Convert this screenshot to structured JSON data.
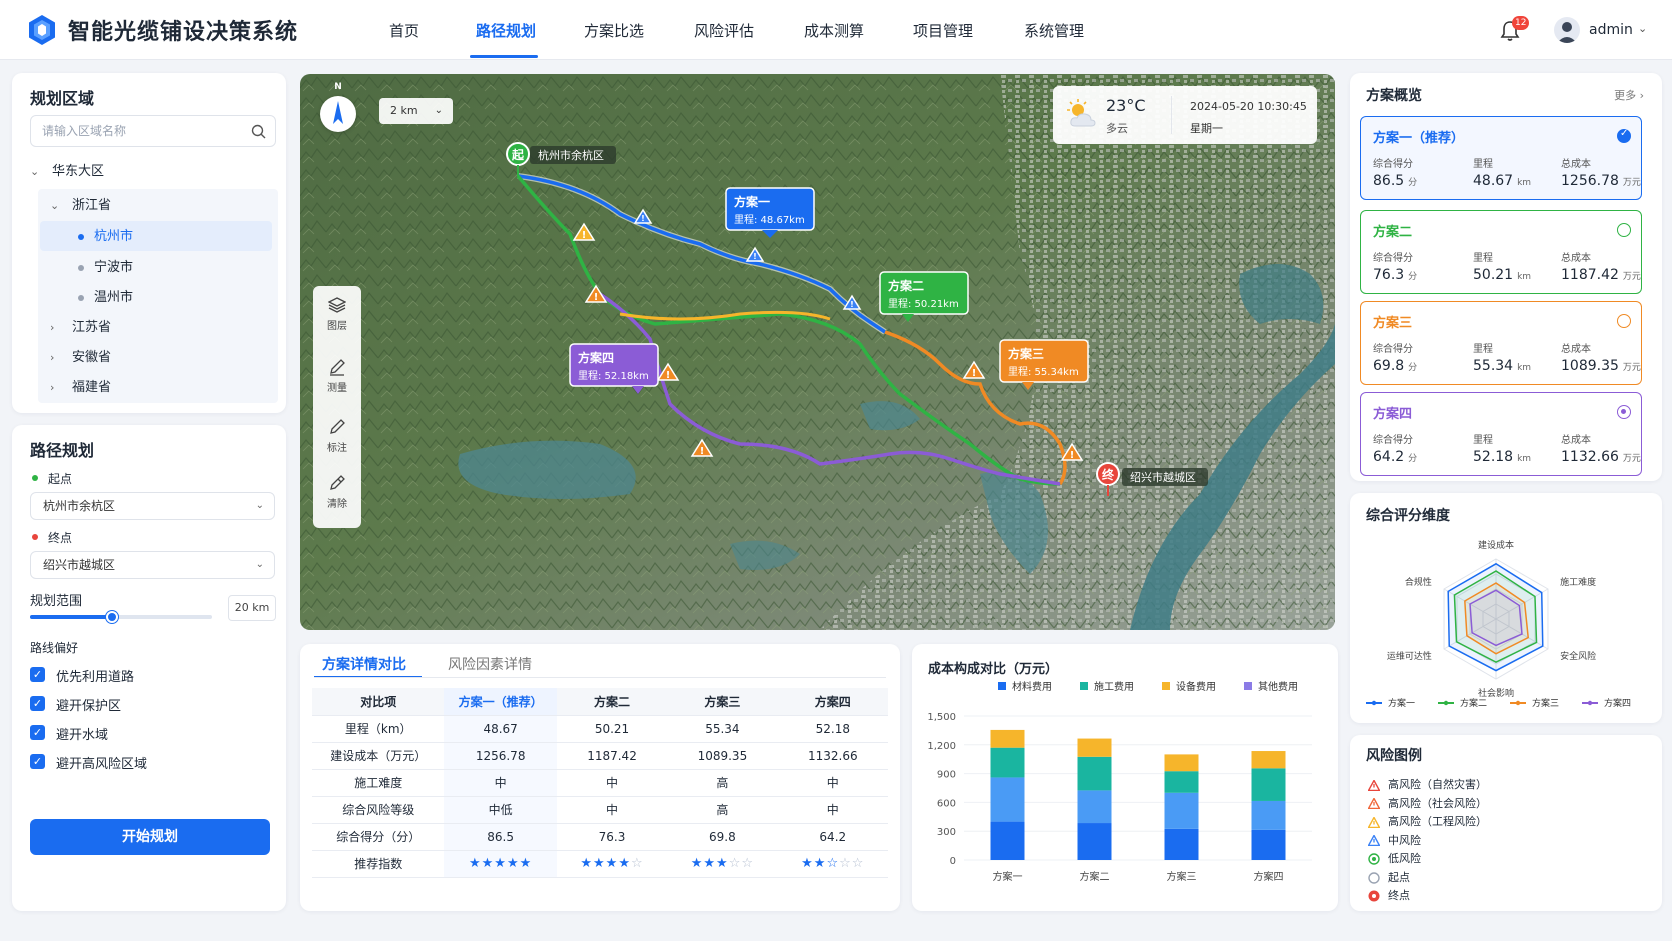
{
  "header": {
    "app_title": "智能光缆铺设决策系统",
    "nav": [
      "首页",
      "路径规划",
      "方案比选",
      "风险评估",
      "成本测算",
      "项目管理",
      "系统管理"
    ],
    "active_nav": "路径规划",
    "notification_count": "12",
    "username": "admin"
  },
  "region": {
    "title": "规划区域",
    "search_placeholder": "请输入区域名称",
    "tree": {
      "root": "华东大区",
      "province_open": "浙江省",
      "cities": [
        "杭州市",
        "宁波市",
        "温州市"
      ],
      "selected_city": "杭州市",
      "other_provinces": [
        "江苏省",
        "安徽省",
        "福建省"
      ]
    }
  },
  "route": {
    "title": "路径规划",
    "start_label": "起点",
    "start_value": "杭州市余杭区",
    "end_label": "终点",
    "end_value": "绍兴市越城区",
    "range_label": "规划范围",
    "range_value": "20 km",
    "range_fraction": 0.45,
    "pref_label": "路线偏好",
    "prefs": [
      "优先利用道路",
      "避开保护区",
      "避开水域",
      "避开高风险区域"
    ],
    "start_button": "开始规划"
  },
  "map": {
    "scale": "2 km",
    "compass": "N",
    "weather": {
      "temp": "23°C",
      "desc": "多云",
      "datetime": "2024-05-20 10:30:45",
      "weekday": "星期一"
    },
    "tools": [
      "图层",
      "测量",
      "标注",
      "清除"
    ],
    "start_marker": "起",
    "start_name": "杭州市余杭区",
    "end_marker": "终",
    "end_name": "绍兴市越城区",
    "routes": [
      {
        "name": "方案一",
        "distance": "里程: 48.67km",
        "color": "#1a6cf0"
      },
      {
        "name": "方案二",
        "distance": "里程: 50.21km",
        "color": "#2fb344"
      },
      {
        "name": "方案三",
        "distance": "里程: 55.34km",
        "color": "#f08a24"
      },
      {
        "name": "方案四",
        "distance": "里程: 52.18km",
        "color": "#8b5cd6"
      }
    ]
  },
  "overview": {
    "title": "方案概览",
    "more": "更多 ›",
    "plans": [
      {
        "name": "方案一（推荐）",
        "score_label": "综合得分",
        "score": "86.5",
        "score_unit": "分",
        "dist_label": "里程",
        "dist": "48.67",
        "dist_unit": "km",
        "cost_label": "总成本",
        "cost": "1256.78",
        "cost_unit": "万元",
        "color": "#1a6cf0"
      },
      {
        "name": "方案二",
        "score_label": "综合得分",
        "score": "76.3",
        "score_unit": "分",
        "dist_label": "里程",
        "dist": "50.21",
        "dist_unit": "km",
        "cost_label": "总成本",
        "cost": "1187.42",
        "cost_unit": "万元",
        "color": "#2fb344"
      },
      {
        "name": "方案三",
        "score_label": "综合得分",
        "score": "69.8",
        "score_unit": "分",
        "dist_label": "里程",
        "dist": "55.34",
        "dist_unit": "km",
        "cost_label": "总成本",
        "cost": "1089.35",
        "cost_unit": "万元",
        "color": "#f08a24"
      },
      {
        "name": "方案四",
        "score_label": "综合得分",
        "score": "64.2",
        "score_unit": "分",
        "dist_label": "里程",
        "dist": "52.18",
        "dist_unit": "km",
        "cost_label": "总成本",
        "cost": "1132.66",
        "cost_unit": "万元",
        "color": "#8b5cd6"
      }
    ]
  },
  "compare": {
    "tabs": [
      "方案详情对比",
      "风险因素详情"
    ],
    "headers": [
      "对比项",
      "方案一（推荐）",
      "方案二",
      "方案三",
      "方案四"
    ],
    "rows": [
      [
        "里程（km）",
        "48.67",
        "50.21",
        "55.34",
        "52.18"
      ],
      [
        "建设成本（万元）",
        "1256.78",
        "1187.42",
        "1089.35",
        "1132.66"
      ],
      [
        "施工难度",
        "中",
        "中",
        "高",
        "中"
      ],
      [
        "综合风险等级",
        "中低",
        "中",
        "高",
        "中"
      ],
      [
        "综合得分（分）",
        "86.5",
        "76.3",
        "69.8",
        "64.2"
      ]
    ],
    "rec_label": "推荐指数",
    "rec_stars": [
      5,
      4,
      3,
      2.5
    ]
  },
  "chart_data": [
    {
      "type": "bar",
      "stacked": true,
      "title": "成本构成对比（万元）",
      "categories": [
        "方案一",
        "方案二",
        "方案三",
        "方案四"
      ],
      "series": [
        {
          "name": "材料费用",
          "values": [
            400,
            385,
            325,
            315
          ],
          "color": "#1a6cf0"
        },
        {
          "name": "施工费用",
          "values": [
            460,
            340,
            375,
            300
          ],
          "color": "#4a9bf5"
        },
        {
          "name": "设备费用",
          "values": [
            310,
            350,
            225,
            340
          ],
          "color": "#1ab5a0"
        },
        {
          "name": "其他费用",
          "values": [
            185,
            190,
            175,
            180
          ],
          "color": "#f6b52b"
        }
      ],
      "ylim": [
        0,
        1500
      ],
      "yticks": [
        "1,500",
        "1,200",
        "900",
        "600",
        "300",
        "0"
      ],
      "legend_names": [
        "材料费用",
        "施工费用",
        "设备费用",
        "其他费用"
      ],
      "legend_colors": [
        "#1a6cf0",
        "#1ab5a0",
        "#f6b52b",
        "#8b7be6"
      ]
    },
    {
      "type": "radar",
      "title": "综合评分维度",
      "axes": [
        "建设成本",
        "施工难度",
        "安全风险",
        "社会影响",
        "运维可达性",
        "合规性"
      ],
      "series": [
        {
          "name": "方案一",
          "values": [
            92,
            88,
            90,
            86,
            90,
            92
          ],
          "color": "#1a6cf0"
        },
        {
          "name": "方案二",
          "values": [
            80,
            75,
            78,
            72,
            76,
            80
          ],
          "color": "#2fb344"
        },
        {
          "name": "方案三",
          "values": [
            60,
            55,
            62,
            58,
            56,
            60
          ],
          "color": "#f08a24"
        },
        {
          "name": "方案四",
          "values": [
            48,
            45,
            50,
            44,
            46,
            50
          ],
          "color": "#8b5cd6"
        }
      ]
    }
  ],
  "risk_legend": {
    "title": "风险图例",
    "items": [
      {
        "label": "高风险（自然灾害）",
        "color": "#e8453c"
      },
      {
        "label": "高风险（社会风险）",
        "color": "#f0663a"
      },
      {
        "label": "高风险（工程风险）",
        "color": "#f6b52b"
      },
      {
        "label": "中风险",
        "color": "#3b82f6"
      },
      {
        "label": "低风险",
        "color": "#2fb344"
      },
      {
        "label": "起点",
        "color": "#9aa3b2"
      },
      {
        "label": "终点",
        "color": "#e8453c"
      }
    ]
  }
}
